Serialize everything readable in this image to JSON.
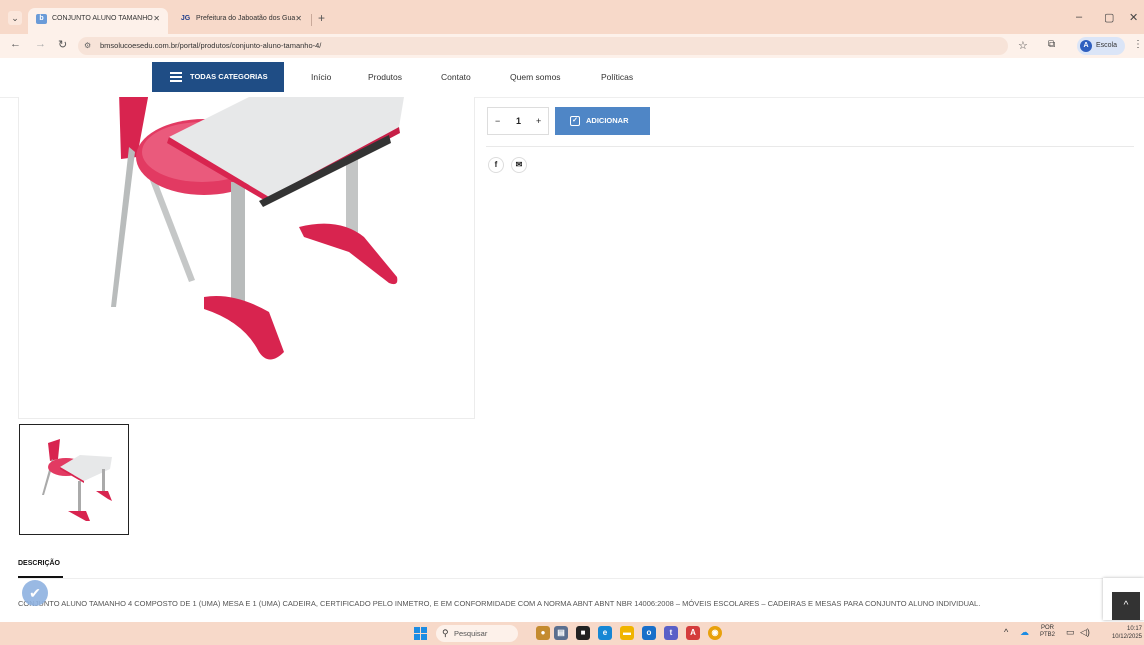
{
  "browser": {
    "tabs": [
      {
        "label": "CONJUNTO ALUNO TAMANHO",
        "favicon": "bm-favicon"
      },
      {
        "label": "Prefeitura do Jaboatão dos Gua",
        "favicon": "JG"
      }
    ],
    "url": "bmsolucoesedu.com.br/portal/produtos/conjunto-aluno-tamanho-4/",
    "profile_label": "Escola",
    "profile_initial": "A"
  },
  "sitenav": {
    "categories_label": "TODAS CATEGORIAS",
    "links": [
      "Início",
      "Produtos",
      "Contato",
      "Quem somos",
      "Políticas"
    ]
  },
  "product": {
    "quantity": "1",
    "qty_minus": "−",
    "qty_plus": "+",
    "add_label": "ADICIONAR",
    "share": {
      "facebook": "f",
      "email": "✉"
    }
  },
  "description": {
    "tab_label": "DESCRIÇÃO",
    "text": "CONJUNTO ALUNO TAMANHO 4 COMPOSTO DE 1 (UMA) MESA E 1 (UMA) CADEIRA, CERTIFICADO PELO INMETRO, E EM CONFORMIDADE COM A NORMA ABNT ABNT NBR 14006:2008 – MÓVEIS ESCOLARES – CADEIRAS E MESAS PARA CONJUNTO ALUNO INDIVIDUAL."
  },
  "taskbar": {
    "search_placeholder": "Pesquisar",
    "lang_top": "POR",
    "lang_bottom": "PTB2",
    "time": "10:17",
    "date": "10/12/2025"
  },
  "colors": {
    "accent_dark": "#1f4d85",
    "accent_button": "#4f86c6",
    "product_red": "#d8244f"
  }
}
